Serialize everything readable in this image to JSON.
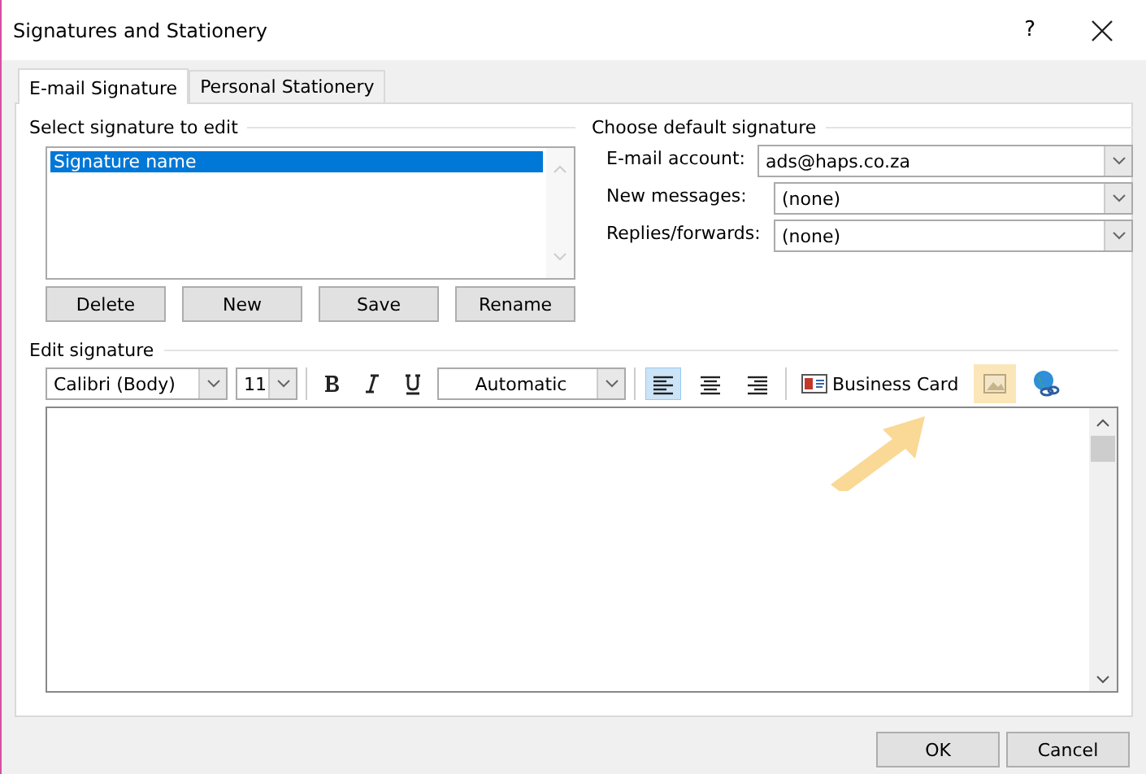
{
  "window": {
    "title": "Signatures and Stationery",
    "help": "?"
  },
  "tabs": [
    {
      "label": "E-mail Signature",
      "selected": true
    },
    {
      "label": "Personal Stationery",
      "selected": false
    }
  ],
  "signature_list": {
    "heading": "Select signature to edit",
    "items": [
      {
        "label": "Signature name",
        "selected": true
      }
    ]
  },
  "signature_buttons": [
    "Delete",
    "New",
    "Save",
    "Rename"
  ],
  "default_signature": {
    "heading": "Choose default signature",
    "fields": [
      {
        "label": "E-mail account:",
        "value": "ads@haps.co.za"
      },
      {
        "label": "New messages:",
        "value": "(none)"
      },
      {
        "label": "Replies/forwards:",
        "value": "(none)"
      }
    ]
  },
  "editor": {
    "heading": "Edit signature",
    "font": "Calibri (Body)",
    "size": "11",
    "font_color_setting": "Automatic",
    "align_buttons": [
      {
        "kind": "left",
        "selected": true
      },
      {
        "kind": "center",
        "selected": false
      },
      {
        "kind": "right",
        "selected": false
      }
    ],
    "business_card": "Business Card",
    "picture_button_highlighted": true
  },
  "footer_buttons": [
    "OK",
    "Cancel"
  ]
}
